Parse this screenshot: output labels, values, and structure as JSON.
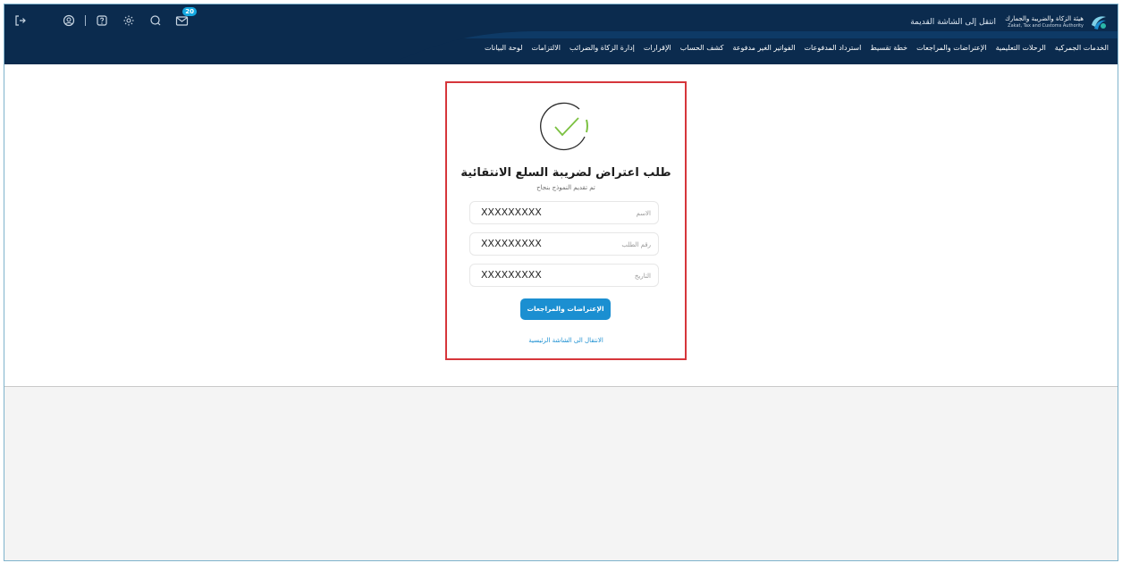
{
  "header": {
    "brand_ar": "هيئة الزكاة والضريبة والجمارك",
    "brand_en": "Zakat, Tax and Customs Authority",
    "old_screen_link": "انتقل إلى الشاشة القديمة",
    "notification_count": "20",
    "icons": [
      "logout-icon",
      "profile-icon",
      "help-icon",
      "settings-icon",
      "chat-icon",
      "mail-icon"
    ]
  },
  "nav": {
    "items": [
      "لوحة البيانات",
      "الالتزامات",
      "إدارة الزكاة والضرائب",
      "الإقرارات",
      "كشف الحساب",
      "الفواتير الغير مدفوعة",
      "استرداد المدفوعات",
      "خطة تقسيط",
      "الإعتراضات والمراجعات",
      "الرحلات التعليمية",
      "الخدمات الجمركية"
    ]
  },
  "card": {
    "title": "طلب اعتراض لضريبة السلع الانتقائية",
    "subtitle": "تم تقديم النموذج بنجاح",
    "fields": [
      {
        "label": "الاسم",
        "value": "XXXXXXXXX"
      },
      {
        "label": "رقم الطلب",
        "value": "XXXXXXXXX"
      },
      {
        "label": "التاريخ",
        "value": "XXXXXXXXX"
      }
    ],
    "primary_button": "الإعتراضات والمراجعات",
    "home_link": "الانتقال الى الشاشة الرئيسية"
  },
  "colors": {
    "header_bg": "#0b2b4e",
    "accent": "#1b8fd1",
    "highlight_border": "#d6363b",
    "success_green": "#7cc142"
  }
}
